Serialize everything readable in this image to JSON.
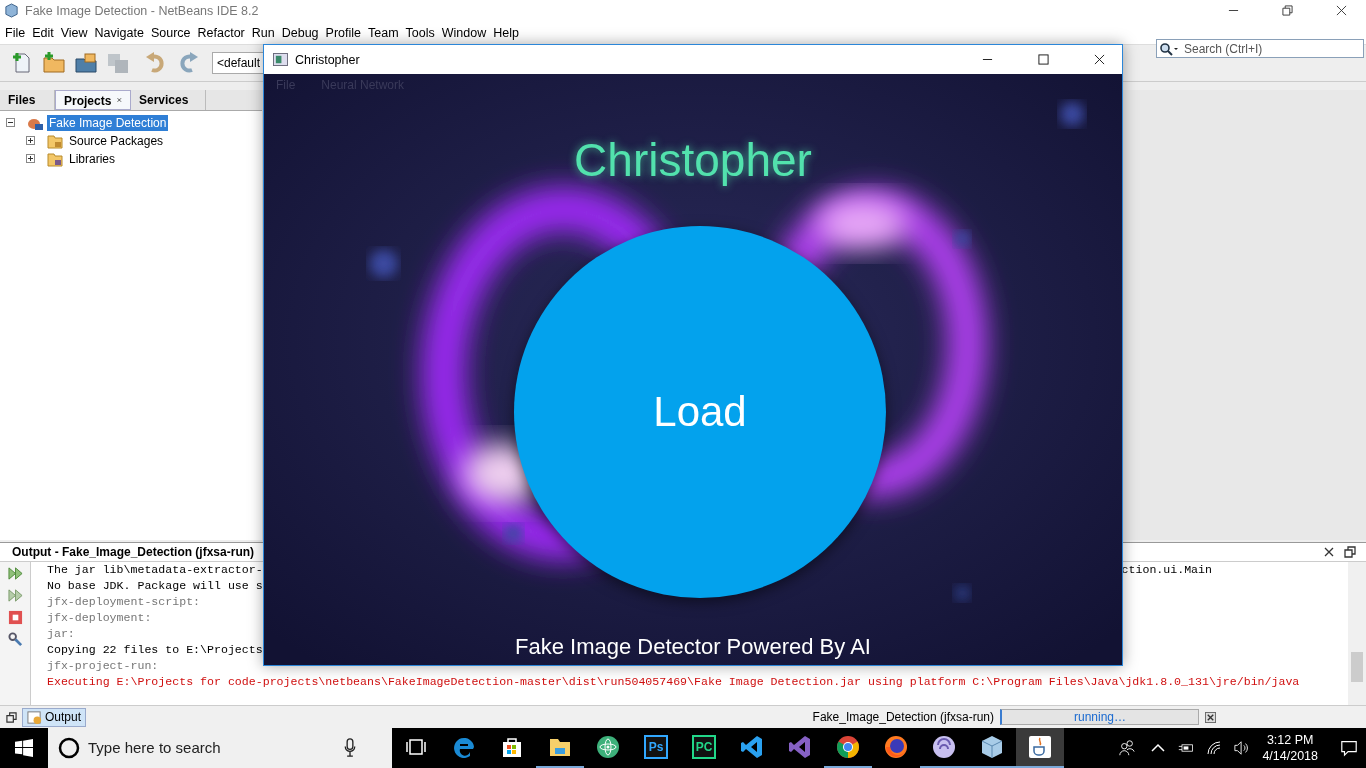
{
  "ide": {
    "title": "Fake Image Detection - NetBeans IDE 8.2",
    "menu": [
      "File",
      "Edit",
      "View",
      "Navigate",
      "Source",
      "Refactor",
      "Run",
      "Debug",
      "Profile",
      "Team",
      "Tools",
      "Window",
      "Help"
    ],
    "toolbar": [
      {
        "kind": "new-file",
        "disabled": false
      },
      {
        "kind": "new-project",
        "disabled": false
      },
      {
        "kind": "open-project",
        "disabled": false
      },
      {
        "kind": "save-all",
        "disabled": true
      },
      {
        "kind": "undo",
        "disabled": false
      },
      {
        "kind": "redo",
        "disabled": false
      }
    ],
    "config": "<default",
    "search": {
      "placeholder": "Search (Ctrl+I)"
    }
  },
  "panel_tabs": [
    {
      "label": "Files",
      "selected": false,
      "closable": false
    },
    {
      "label": "Projects",
      "selected": true,
      "closable": true
    },
    {
      "label": "Services",
      "selected": false,
      "closable": false
    }
  ],
  "tree": [
    {
      "label": "Fake Image Detection",
      "kind": "project",
      "selected": true,
      "expanded": true,
      "children": [
        {
          "label": "Source Packages",
          "kind": "packages",
          "selected": false,
          "expanded": false
        },
        {
          "label": "Libraries",
          "kind": "libraries",
          "selected": false,
          "expanded": false
        }
      ]
    }
  ],
  "output": {
    "title": "Output - Fake_Image_Detection (jfxsa-run)",
    "lines": [
      {
        "text": "The jar lib\\metadata-extractor-",
        "tail": "ction.ui.Main",
        "kind": "normal"
      },
      {
        "text": "No base JDK. Package will use s",
        "kind": "normal"
      },
      {
        "text": "jfx-deployment-script:",
        "kind": "muted"
      },
      {
        "text": "jfx-deployment:",
        "kind": "muted"
      },
      {
        "text": "jar:",
        "kind": "muted"
      },
      {
        "text": "Copying 22 files to E:\\Projects",
        "kind": "normal"
      },
      {
        "text": "jfx-project-run:",
        "kind": "muted"
      },
      {
        "text": "Executing E:\\Projects for code-projects\\netbeans\\FakeImageDetection-master\\dist\\run504057469\\Fake Image Detection.jar using platform C:\\Program Files\\Java\\jdk1.8.0_131\\jre/bin/java",
        "kind": "error"
      }
    ]
  },
  "status_bar": {
    "tab": "Output",
    "task": "Fake_Image_Detection (jfxsa-run)",
    "progress": "running…"
  },
  "app": {
    "title": "Christopher",
    "menu": [
      "File",
      "Neural Network"
    ],
    "heading": "Christopher",
    "button": "Load",
    "footer": "Fake Image Detector Powered By AI"
  },
  "taskbar": {
    "search": {
      "placeholder": "Type here to search"
    },
    "apps": [
      {
        "kind": "taskview",
        "running": false,
        "active": false
      },
      {
        "kind": "edge",
        "running": false,
        "active": false
      },
      {
        "kind": "store",
        "running": false,
        "active": false
      },
      {
        "kind": "folder",
        "running": true,
        "active": false
      },
      {
        "kind": "atom",
        "running": false,
        "active": false
      },
      {
        "kind": "tile",
        "label": "Ps",
        "color": "#31a8ff",
        "running": false,
        "active": false
      },
      {
        "kind": "tile",
        "label": "PC",
        "color": "#21d789",
        "running": false,
        "active": false
      },
      {
        "kind": "ribbon",
        "color": "#2aa1f0",
        "running": false,
        "active": false
      },
      {
        "kind": "ribbon",
        "color": "#8661c5",
        "running": false,
        "active": false
      },
      {
        "kind": "chrome",
        "running": true,
        "active": false
      },
      {
        "kind": "firefox",
        "running": false,
        "active": false
      },
      {
        "kind": "disc",
        "running": true,
        "active": false
      },
      {
        "kind": "cube",
        "running": true,
        "active": false
      },
      {
        "kind": "cup",
        "running": true,
        "active": true
      }
    ],
    "time": "3:12 PM",
    "date": "4/14/2018"
  }
}
